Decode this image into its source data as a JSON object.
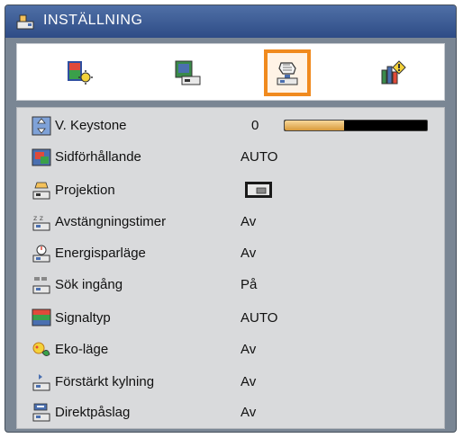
{
  "menu": {
    "title": "INSTÄLLNING",
    "title_icon": "setup-icon",
    "tabs": [
      {
        "name": "image-settings-tab",
        "icon": "picture-palette-icon"
      },
      {
        "name": "display-settings-tab",
        "icon": "display-screen-icon"
      },
      {
        "name": "setup-tab",
        "icon": "setup-hand-icon",
        "active": true
      },
      {
        "name": "options-tab",
        "icon": "options-info-icon"
      }
    ],
    "accent_color": "#f08a1e"
  },
  "settings": {
    "keystone": {
      "label": "V. Keystone",
      "value": "0",
      "level": 0.42
    },
    "aspect": {
      "label": "Sidförhållande",
      "value": "AUTO"
    },
    "projection": {
      "label": "Projektion",
      "value_icon": "front-projection-icon"
    },
    "sleep_timer": {
      "label": "Avstängningstimer",
      "value": "Av"
    },
    "power_save": {
      "label": "Energisparläge",
      "value": "Av"
    },
    "source_search": {
      "label": "Sök ingång",
      "value": "På"
    },
    "signal_type": {
      "label": "Signaltyp",
      "value": "AUTO"
    },
    "eco_mode": {
      "label": "Eko-läge",
      "value": "Av"
    },
    "high_cooling": {
      "label": "Förstärkt kylning",
      "value": "Av"
    },
    "direct_power": {
      "label": "Direktpåslag",
      "value": "Av"
    }
  }
}
